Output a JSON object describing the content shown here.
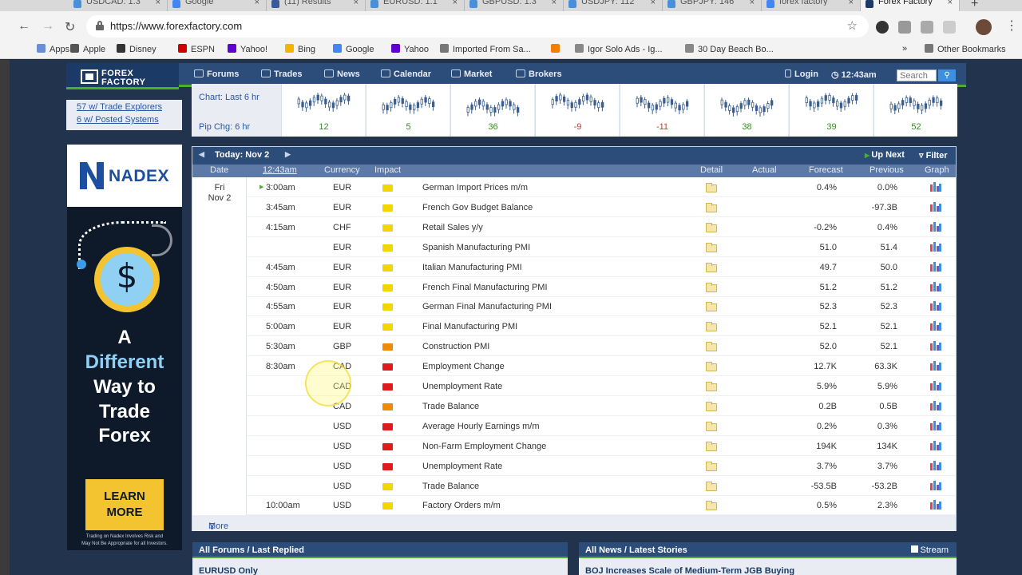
{
  "browser": {
    "tabs": [
      {
        "title": "USDCAD: 1.3",
        "icon": "forex-factory-icon",
        "color": "#4a90d9"
      },
      {
        "title": "Google",
        "icon": "google-icon",
        "color": "#4285f4"
      },
      {
        "title": "(11) Results",
        "icon": "facebook-icon",
        "color": "#3b5998"
      },
      {
        "title": "EURUSD: 1.1",
        "icon": "forex-factory-icon",
        "color": "#4a90d9"
      },
      {
        "title": "GBPUSD: 1.3",
        "icon": "forex-factory-icon",
        "color": "#4a90d9"
      },
      {
        "title": "USDJPY: 112",
        "icon": "forex-factory-icon",
        "color": "#4a90d9"
      },
      {
        "title": "GBPJPY: 146",
        "icon": "forex-factory-icon",
        "color": "#4a90d9"
      },
      {
        "title": "forex factory",
        "icon": "google-icon",
        "color": "#4285f4"
      },
      {
        "title": "Forex Factory",
        "icon": "forex-factory-icon",
        "color": "#1c3a66",
        "active": true
      }
    ],
    "new_tab": "+",
    "url": "https://www.forexfactory.com",
    "bookmarks": [
      {
        "label": "Apps",
        "icon": "apps-grid-icon",
        "color": "#6a8fd6"
      },
      {
        "label": "Apple",
        "icon": "apple-icon",
        "color": "#555555"
      },
      {
        "label": "Disney",
        "icon": "disney-icon",
        "color": "#333333"
      },
      {
        "label": "ESPN",
        "icon": "espn-icon",
        "color": "#d00000"
      },
      {
        "label": "Yahoo!",
        "icon": "yahoo-icon",
        "color": "#5f01d1"
      },
      {
        "label": "Bing",
        "icon": "bing-icon",
        "color": "#f2b600"
      },
      {
        "label": "Google",
        "icon": "google-icon",
        "color": "#4285f4"
      },
      {
        "label": "Yahoo",
        "icon": "yahoo-icon",
        "color": "#5f01d1"
      },
      {
        "label": "Imported From Sa...",
        "icon": "folder-icon",
        "color": "#777777"
      },
      {
        "label": "",
        "icon": "blogger-icon",
        "color": "#f57d00"
      },
      {
        "label": "Igor Solo Ads - Ig...",
        "icon": "page-icon",
        "color": "#888888"
      },
      {
        "label": "30 Day Beach Bo...",
        "icon": "page-icon",
        "color": "#888888"
      }
    ],
    "bookmarks_overflow": "»",
    "other_bookmarks": "Other Bookmarks"
  },
  "site": {
    "logo": {
      "line1": "FOREX",
      "line2": "FACTORY"
    },
    "nav": [
      {
        "label": "Forums",
        "icon": "forums-icon"
      },
      {
        "label": "Trades",
        "icon": "trades-icon"
      },
      {
        "label": "News",
        "icon": "news-icon"
      },
      {
        "label": "Calendar",
        "icon": "calendar-icon"
      },
      {
        "label": "Market",
        "icon": "market-icon"
      },
      {
        "label": "Brokers",
        "icon": "brokers-icon"
      }
    ],
    "login": "Login",
    "time": "12:43am",
    "search_placeholder": "Search"
  },
  "sidebar": {
    "links": [
      "57 w/ Trade Explorers",
      "6 w/ Posted Systems"
    ]
  },
  "ad": {
    "brand": "NADEX",
    "line1": "A",
    "line2": "Different",
    "line3": "Way to",
    "line4": "Trade",
    "line5": "Forex",
    "cta1": "LEARN",
    "cta2": "MORE",
    "disclaimer1": "Trading on Nadex Involves Risk and",
    "disclaimer2": "May Not Be Appropriate for all Investors."
  },
  "chart_strip": {
    "label_chart": "Chart: Last 6 hr",
    "label_pips": "Pip Chg: 6 hr",
    "values": [
      "12",
      "5",
      "36",
      "-9",
      "-11",
      "38",
      "39",
      "52"
    ],
    "value_colors": [
      "#3b8a25",
      "#3b8a25",
      "#3b8a25",
      "#c0392b",
      "#c0392b",
      "#3b8a25",
      "#3b8a25",
      "#3b8a25"
    ]
  },
  "calendar": {
    "today": "Today: Nov 2",
    "up_next": "Up Next",
    "filter": "Filter",
    "columns": {
      "date": "Date",
      "time": "12:43am",
      "currency": "Currency",
      "impact": "Impact",
      "detail": "Detail",
      "actual": "Actual",
      "forecast": "Forecast",
      "previous": "Previous",
      "graph": "Graph"
    },
    "date_line1": "Fri",
    "date_line2": "Nov 2",
    "impact_colors": {
      "low": "#f2d600",
      "medium": "#f08a00",
      "high": "#e01b1b"
    },
    "rows": [
      {
        "time": "3:00am",
        "currency": "EUR",
        "impact": "low",
        "event": "German Import Prices m/m",
        "actual": "",
        "forecast": "0.4%",
        "previous": "0.0%"
      },
      {
        "time": "3:45am",
        "currency": "EUR",
        "impact": "low",
        "event": "French Gov Budget Balance",
        "actual": "",
        "forecast": "",
        "previous": "-97.3B"
      },
      {
        "time": "4:15am",
        "currency": "CHF",
        "impact": "low",
        "event": "Retail Sales y/y",
        "actual": "",
        "forecast": "-0.2%",
        "previous": "0.4%"
      },
      {
        "time": "",
        "currency": "EUR",
        "impact": "low",
        "event": "Spanish Manufacturing PMI",
        "actual": "",
        "forecast": "51.0",
        "previous": "51.4"
      },
      {
        "time": "4:45am",
        "currency": "EUR",
        "impact": "low",
        "event": "Italian Manufacturing PMI",
        "actual": "",
        "forecast": "49.7",
        "previous": "50.0"
      },
      {
        "time": "4:50am",
        "currency": "EUR",
        "impact": "low",
        "event": "French Final Manufacturing PMI",
        "actual": "",
        "forecast": "51.2",
        "previous": "51.2"
      },
      {
        "time": "4:55am",
        "currency": "EUR",
        "impact": "low",
        "event": "German Final Manufacturing PMI",
        "actual": "",
        "forecast": "52.3",
        "previous": "52.3"
      },
      {
        "time": "5:00am",
        "currency": "EUR",
        "impact": "low",
        "event": "Final Manufacturing PMI",
        "actual": "",
        "forecast": "52.1",
        "previous": "52.1"
      },
      {
        "time": "5:30am",
        "currency": "GBP",
        "impact": "medium",
        "event": "Construction PMI",
        "actual": "",
        "forecast": "52.0",
        "previous": "52.1"
      },
      {
        "time": "8:30am",
        "currency": "CAD",
        "impact": "high",
        "event": "Employment Change",
        "actual": "",
        "forecast": "12.7K",
        "previous": "63.3K"
      },
      {
        "time": "",
        "currency": "CAD",
        "impact": "high",
        "event": "Unemployment Rate",
        "actual": "",
        "forecast": "5.9%",
        "previous": "5.9%"
      },
      {
        "time": "",
        "currency": "CAD",
        "impact": "medium",
        "event": "Trade Balance",
        "actual": "",
        "forecast": "0.2B",
        "previous": "0.5B"
      },
      {
        "time": "",
        "currency": "USD",
        "impact": "high",
        "event": "Average Hourly Earnings m/m",
        "actual": "",
        "forecast": "0.2%",
        "previous": "0.3%"
      },
      {
        "time": "",
        "currency": "USD",
        "impact": "high",
        "event": "Non-Farm Employment Change",
        "actual": "",
        "forecast": "194K",
        "previous": "134K"
      },
      {
        "time": "",
        "currency": "USD",
        "impact": "high",
        "event": "Unemployment Rate",
        "actual": "",
        "forecast": "3.7%",
        "previous": "3.7%"
      },
      {
        "time": "",
        "currency": "USD",
        "impact": "low",
        "event": "Trade Balance",
        "actual": "",
        "forecast": "-53.5B",
        "previous": "-53.2B"
      },
      {
        "time": "10:00am",
        "currency": "USD",
        "impact": "low",
        "event": "Factory Orders m/m",
        "actual": "",
        "forecast": "0.5%",
        "previous": "2.3%"
      }
    ],
    "more": "More"
  },
  "panels": {
    "forums_title": "All Forums / Last Replied",
    "forums_item": "EURUSD Only",
    "news_title": "All News / Latest Stories",
    "news_stream": "Stream",
    "news_item": "BOJ Increases Scale of Medium-Term JGB Buying"
  }
}
